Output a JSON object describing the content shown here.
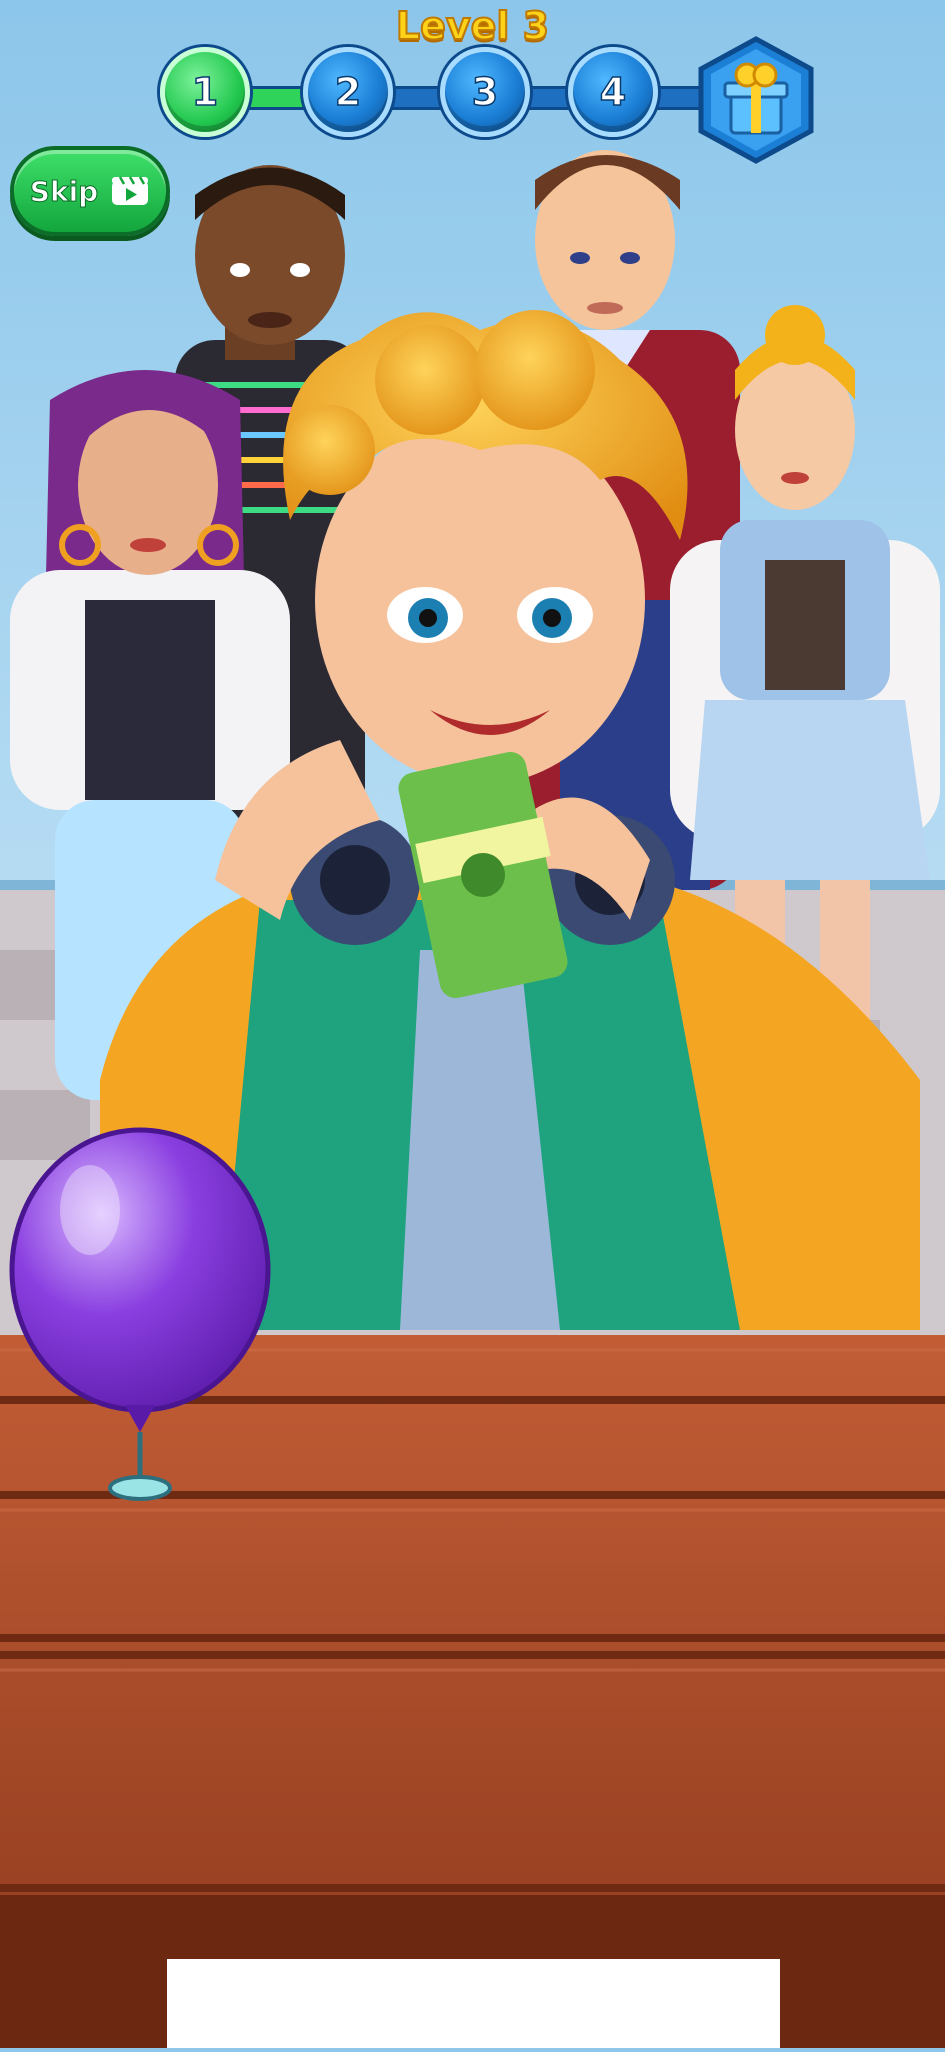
{
  "hud": {
    "level_label": "Level 3"
  },
  "progress": {
    "steps": [
      "1",
      "2",
      "3",
      "4"
    ],
    "current_step": 1,
    "reward_icon": "gift-box-icon"
  },
  "skip": {
    "label": "Skip",
    "icon": "video-ad-icon"
  },
  "colors": {
    "sky": "#8fc7ea",
    "wall": "#a9d4ef",
    "floor": "#c9c2c7",
    "table": "#b8552f",
    "balloon": "#8a3fe0",
    "accent_green": "#22c84f",
    "accent_blue": "#1b7fd6",
    "title_yellow": "#ffd21a"
  }
}
